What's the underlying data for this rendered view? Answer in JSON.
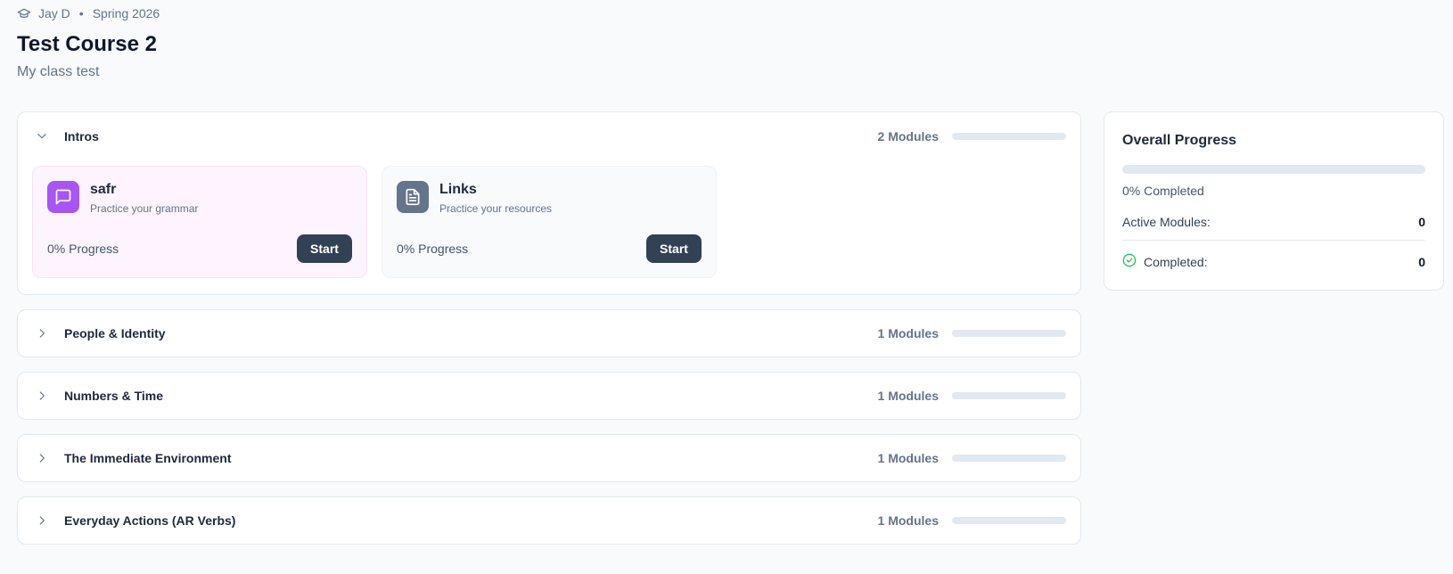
{
  "header": {
    "instructor": "Jay D",
    "separator": "•",
    "term": "Spring 2026",
    "title": "Test Course 2",
    "subtitle": "My class test"
  },
  "units": [
    {
      "title": "Intros",
      "count_label": "2 Modules",
      "progress": 0,
      "expanded": true,
      "modules": [
        {
          "name": "safr",
          "description": "Practice your grammar",
          "progress_label": "0% Progress",
          "button": "Start",
          "icon": "chat-bubble-icon",
          "color": "#a855f7"
        },
        {
          "name": "Links",
          "description": "Practice your resources",
          "progress_label": "0% Progress",
          "button": "Start",
          "icon": "document-icon",
          "color": "#64748b"
        }
      ]
    },
    {
      "title": "People & Identity",
      "count_label": "1 Modules",
      "progress": 0,
      "expanded": false
    },
    {
      "title": "Numbers & Time",
      "count_label": "1 Modules",
      "progress": 0,
      "expanded": false
    },
    {
      "title": "The Immediate Environment",
      "count_label": "1 Modules",
      "progress": 0,
      "expanded": false
    },
    {
      "title": "Everyday Actions (AR Verbs)",
      "count_label": "1 Modules",
      "progress": 0,
      "expanded": false
    }
  ],
  "overall": {
    "title": "Overall Progress",
    "progress": 0,
    "completed_label": "0% Completed",
    "active_label": "Active Modules:",
    "active_value": "0",
    "done_label": "Completed:",
    "done_value": "0"
  },
  "colors": {
    "accent_dark": "#334155",
    "purple": "#a855f7",
    "success": "#22c55e"
  }
}
